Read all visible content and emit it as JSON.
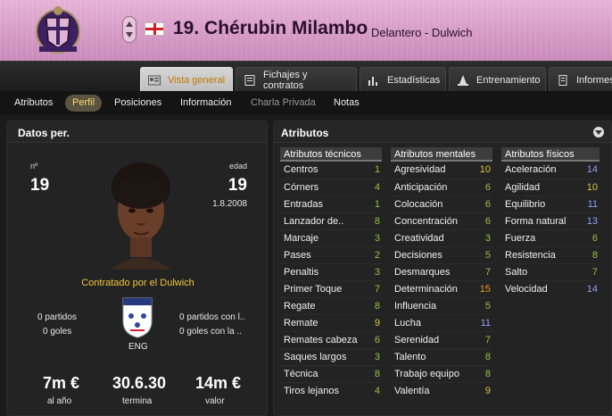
{
  "header": {
    "number_name": "19. Chérubin Milambo",
    "subtitle": "Delantero - Dulwich",
    "nation_flag": "england-flag",
    "colors": {
      "header_bg": "#d59bc6",
      "name": "#2a1030"
    }
  },
  "tabs": [
    {
      "label": "Vista general",
      "icon": "profile-card-icon",
      "active": true
    },
    {
      "label": "Fichajes y contratos",
      "icon": "document-icon",
      "active": false
    },
    {
      "label": "Estadísticas",
      "icon": "bar-chart-icon",
      "active": false
    },
    {
      "label": "Entrenamiento",
      "icon": "cone-icon",
      "active": false
    },
    {
      "label": "Informes",
      "icon": "report-icon",
      "active": false
    }
  ],
  "subtabs": [
    {
      "label": "Atributos",
      "active": false,
      "dim": false
    },
    {
      "label": "Perfil",
      "active": true,
      "dim": false
    },
    {
      "label": "Posiciones",
      "active": false,
      "dim": false
    },
    {
      "label": "Información",
      "active": false,
      "dim": false
    },
    {
      "label": "Charla Privada",
      "active": false,
      "dim": true
    },
    {
      "label": "Notas",
      "active": false,
      "dim": false
    }
  ],
  "personal": {
    "title": "Datos per.",
    "number_label": "nº",
    "number_value": "19",
    "age_label": "edad",
    "age_value": "19",
    "birth_date": "1.8.2008",
    "contracted": "Contratado por el Dulwich",
    "matches_left": "0 partidos",
    "goals_left": "0 goles",
    "matches_right": "0 partidos con l..",
    "goals_right": "0 goles con la ..",
    "nation_code": "ENG",
    "value_1": "7m €",
    "label_1": "al año",
    "value_2": "30.6.30",
    "label_2": "termina",
    "value_3": "14m €",
    "label_3": "valor"
  },
  "attributes": {
    "title": "Atributos",
    "technical": {
      "heading": "Atributos técnicos",
      "rows": [
        {
          "name": "Centros",
          "value": "1",
          "color": "c-green"
        },
        {
          "name": "Córners",
          "value": "4",
          "color": "c-olive"
        },
        {
          "name": "Entradas",
          "value": "1",
          "color": "c-green"
        },
        {
          "name": "Lanzador de..",
          "value": "8",
          "color": "c-green"
        },
        {
          "name": "Marcaje",
          "value": "3",
          "color": "c-green"
        },
        {
          "name": "Pases",
          "value": "2",
          "color": "c-green"
        },
        {
          "name": "Penaltis",
          "value": "3",
          "color": "c-green"
        },
        {
          "name": "Primer Toque",
          "value": "7",
          "color": "c-olive"
        },
        {
          "name": "Regate",
          "value": "8",
          "color": "c-green"
        },
        {
          "name": "Remate",
          "value": "9",
          "color": "c-yellow"
        },
        {
          "name": "Remates cabeza",
          "value": "6",
          "color": "c-olive"
        },
        {
          "name": "Saques largos",
          "value": "3",
          "color": "c-green"
        },
        {
          "name": "Técnica",
          "value": "8",
          "color": "c-green"
        },
        {
          "name": "Tiros lejanos",
          "value": "4",
          "color": "c-olive"
        }
      ]
    },
    "mental": {
      "heading": "Atributos mentales",
      "rows": [
        {
          "name": "Agresividad",
          "value": "10",
          "color": "c-yellow"
        },
        {
          "name": "Anticipación",
          "value": "6",
          "color": "c-olive"
        },
        {
          "name": "Colocación",
          "value": "6",
          "color": "c-olive"
        },
        {
          "name": "Concentración",
          "value": "6",
          "color": "c-olive"
        },
        {
          "name": "Creatividad",
          "value": "3",
          "color": "c-green"
        },
        {
          "name": "Decisiones",
          "value": "5",
          "color": "c-olive"
        },
        {
          "name": "Desmarques",
          "value": "7",
          "color": "c-olive"
        },
        {
          "name": "Determinación",
          "value": "15",
          "color": "c-orange"
        },
        {
          "name": "Influencia",
          "value": "5",
          "color": "c-olive"
        },
        {
          "name": "Lucha",
          "value": "11",
          "color": "c-blue"
        },
        {
          "name": "Serenidad",
          "value": "7",
          "color": "c-olive"
        },
        {
          "name": "Talento",
          "value": "8",
          "color": "c-green"
        },
        {
          "name": "Trabajo equipo",
          "value": "8",
          "color": "c-green"
        },
        {
          "name": "Valentía",
          "value": "9",
          "color": "c-yellow"
        }
      ]
    },
    "physical": {
      "heading": "Atributos físicos",
      "rows": [
        {
          "name": "Aceleración",
          "value": "14",
          "color": "c-blue"
        },
        {
          "name": "Agilidad",
          "value": "10",
          "color": "c-yellow"
        },
        {
          "name": "Equilibrio",
          "value": "11",
          "color": "c-blue"
        },
        {
          "name": "Forma natural",
          "value": "13",
          "color": "c-blue"
        },
        {
          "name": "Fuerza",
          "value": "6",
          "color": "c-olive"
        },
        {
          "name": "Resistencia",
          "value": "8",
          "color": "c-green"
        },
        {
          "name": "Salto",
          "value": "7",
          "color": "c-olive"
        },
        {
          "name": "Velocidad",
          "value": "14",
          "color": "c-blue"
        }
      ]
    }
  }
}
